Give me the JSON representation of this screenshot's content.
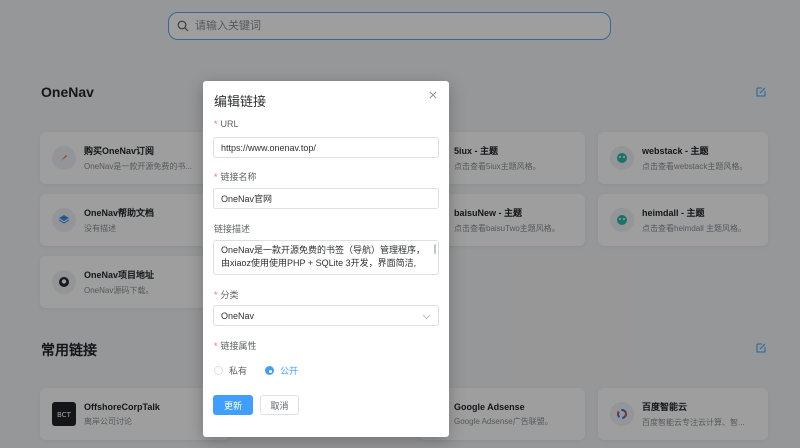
{
  "search": {
    "placeholder": "请输入关键词"
  },
  "sections": [
    {
      "title": "OneNav"
    },
    {
      "title": "常用链接"
    }
  ],
  "cards": {
    "c1": {
      "title": "购买OneNav订阅",
      "desc": "OneNav是一款开源免费的书..."
    },
    "c2": {
      "title": "5iux - 主题",
      "desc": "点击查看5iux主题风格。"
    },
    "c3": {
      "title": "webstack - 主题",
      "desc": "点击查看webstack主题风格。"
    },
    "c4": {
      "title": "OneNav帮助文档",
      "desc": "没有描述"
    },
    "c5": {
      "title": "baisuNew - 主题",
      "desc": "点击查看baisuTwo主题风格。"
    },
    "c6": {
      "title": "heimdall - 主题",
      "desc": "点击查看heimdall 主题风格。"
    },
    "c7": {
      "title": "OneNav项目地址",
      "desc": "OneNav源码下载。"
    },
    "c8": {
      "title": "OffshoreCorpTalk",
      "desc": "离岸公司讨论"
    },
    "c9": {
      "title": "Google Adsense",
      "desc": "Google Adsense广告联盟。"
    },
    "c10": {
      "title": "百度智能云",
      "desc": "百度智能云专注云计算、智..."
    }
  },
  "dialog": {
    "title": "编辑链接",
    "url_label": "URL",
    "url_value": "https://www.onenav.top/",
    "name_label": "链接名称",
    "name_value": "OneNav官网",
    "desc_label": "链接描述",
    "desc_value": "OneNav是一款开源免费的书签（导航）管理程序，由xiaoz使用使用PHP + SQLite 3开发，界面简洁,",
    "category_label": "分类",
    "category_value": "OneNav",
    "attr_label": "链接属性",
    "private_label": "私有",
    "public_label": "公开",
    "update_label": "更新",
    "cancel_label": "取消"
  },
  "colors": {
    "accent": "#409eff",
    "required": "#f56c6c",
    "search_border": "#5ca7f0"
  }
}
